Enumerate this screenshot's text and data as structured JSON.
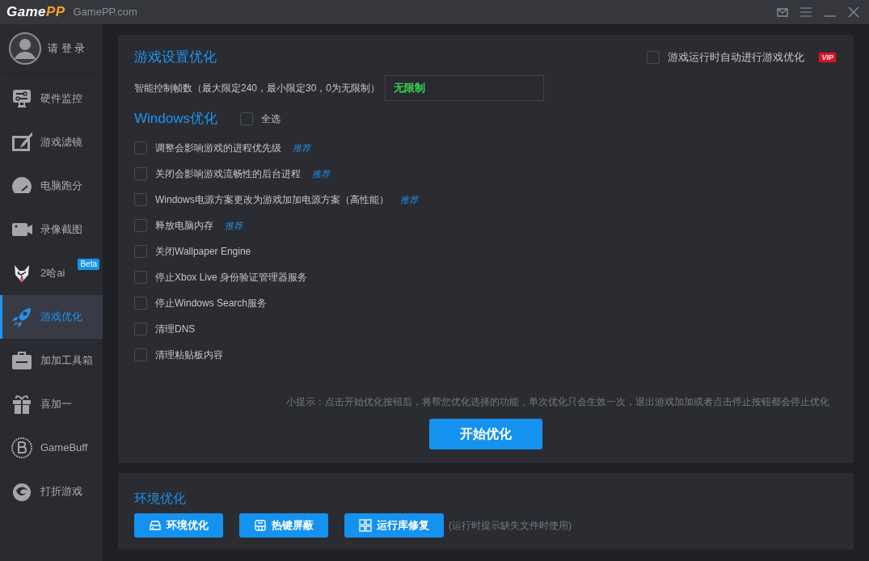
{
  "titlebar": {
    "logo": {
      "lead": "Game",
      "accent": "PP"
    },
    "site": "GamePP.com"
  },
  "user": {
    "login": "请 登 录"
  },
  "sidebar": {
    "items": [
      {
        "label": "硬件监控",
        "selected": false
      },
      {
        "label": "游戏滤镜",
        "selected": false
      },
      {
        "label": "电脑跑分",
        "selected": false
      },
      {
        "label": "录像截图",
        "selected": false
      },
      {
        "label": "2哈ai",
        "selected": false,
        "badge": "Beta"
      },
      {
        "label": "游戏优化",
        "selected": true
      },
      {
        "label": "加加工具箱",
        "selected": false
      },
      {
        "label": "喜加一",
        "selected": false
      },
      {
        "label": "GameBuff",
        "selected": false
      },
      {
        "label": "打折游戏",
        "selected": false
      }
    ]
  },
  "game_settings": {
    "title": "游戏设置优化",
    "auto_optimize": {
      "label": "游戏运行时自动进行游戏优化",
      "checked": false,
      "badge": "VIP"
    },
    "fps_label": "智能控制帧数（最大限定240，最小限定30，0为无限制）",
    "fps_value": "无限制"
  },
  "windows": {
    "title": "Windows优化",
    "select_all": {
      "label": "全选",
      "checked": false
    },
    "options": [
      {
        "label": "调整会影响游戏的进程优先级",
        "checked": false,
        "tag": "推荐"
      },
      {
        "label": "关闭会影响游戏流畅性的后台进程",
        "checked": false,
        "tag": "推荐"
      },
      {
        "label": "Windows电源方案更改为游戏加加电源方案（高性能）",
        "checked": false,
        "tag": "推荐"
      },
      {
        "label": "释放电脑内存",
        "checked": false,
        "tag": "推荐"
      },
      {
        "label": "关闭Wallpaper Engine",
        "checked": false
      },
      {
        "label": "停止Xbox Live 身份验证管理器服务",
        "checked": false
      },
      {
        "label": "停止Windows Search服务",
        "checked": false
      },
      {
        "label": "清理DNS",
        "checked": false
      },
      {
        "label": "清理粘贴板内容",
        "checked": false
      }
    ]
  },
  "tip": "小提示：点击开始优化按钮后，将帮您优化选择的功能，单次优化只会生效一次，退出游戏加加或者点击停止按钮都会停止优化",
  "start_button": "开始优化",
  "environment": {
    "title": "环境优化",
    "buttons": [
      "环境优化",
      "热键屏蔽",
      "运行库修复"
    ],
    "note": "(运行时提示缺失文件时使用)"
  }
}
